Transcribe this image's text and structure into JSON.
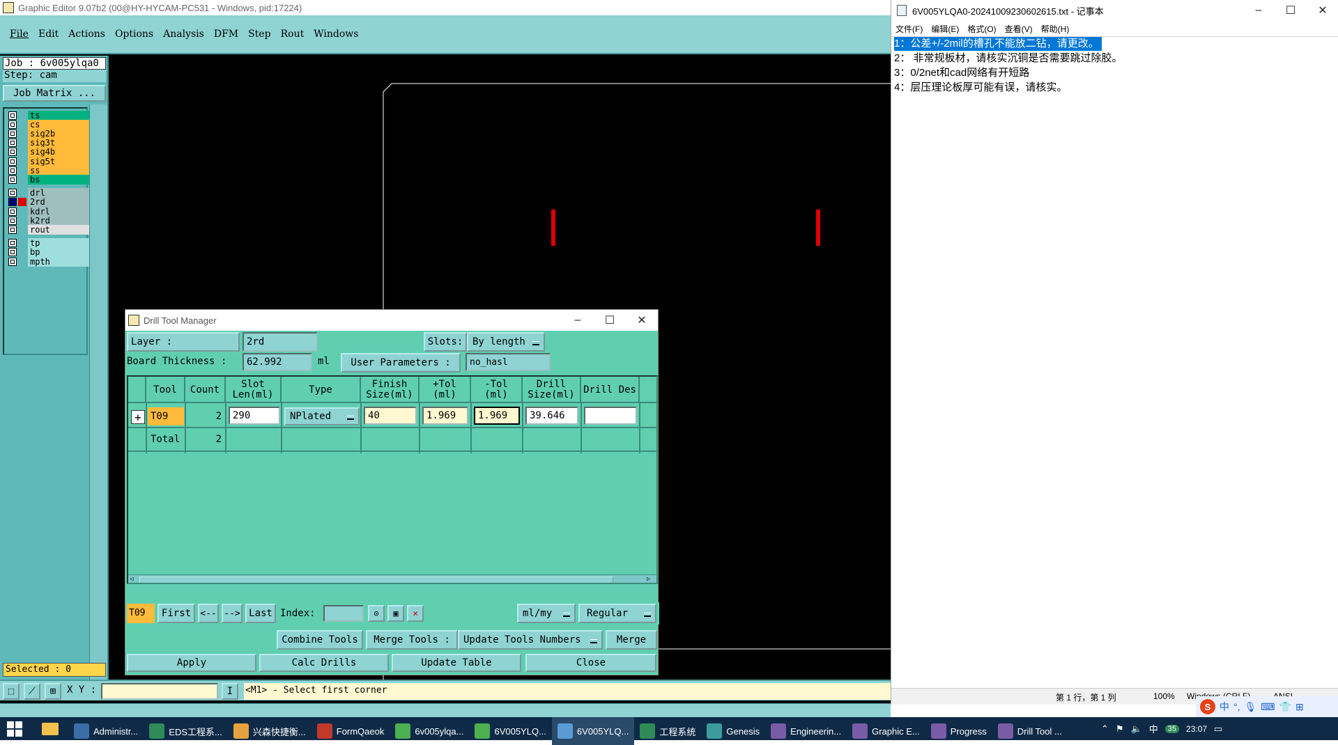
{
  "editor": {
    "title": "Graphic Editor 9.07b2 (00@HY-HYCAM-PC531 - Windows, pid:17224)",
    "menu": [
      "File",
      "Edit",
      "Actions",
      "Options",
      "Analysis",
      "DFM",
      "Step",
      "Rout",
      "Windows"
    ],
    "job_label": "Job : 6v005ylqa0",
    "step_label": "Step: cam",
    "job_matrix_button": "Job Matrix ...",
    "layers": [
      {
        "name": "ts",
        "color": "#00b27f"
      },
      {
        "name": "cs",
        "color": "#ffba3a"
      },
      {
        "name": "sig2b",
        "color": "#ffba3a"
      },
      {
        "name": "sig3t",
        "color": "#ffba3a"
      },
      {
        "name": "sig4b",
        "color": "#ffba3a"
      },
      {
        "name": "sig5t",
        "color": "#ffba3a"
      },
      {
        "name": "ss",
        "color": "#ffba3a"
      },
      {
        "name": "bs",
        "color": "#00b27f"
      },
      {
        "name": "drl",
        "color": "#9fbfbf"
      },
      {
        "name": "2rd",
        "color": "#9fbfbf"
      },
      {
        "name": "kdrl",
        "color": "#9fbfbf"
      },
      {
        "name": "k2rd",
        "color": "#9fbfbf"
      },
      {
        "name": "rout",
        "color": "#e0e0e0"
      },
      {
        "name": "tp",
        "color": "#9fdede"
      },
      {
        "name": "bp",
        "color": "#9fdede"
      },
      {
        "name": "mpth",
        "color": "#9fdede"
      }
    ],
    "selected_label": "Selected : 0",
    "xy_label": "X Y :",
    "status_message": "<M1> - Select first corner"
  },
  "dialog": {
    "title": "Drill Tool Manager",
    "layer_label": "Layer :",
    "layer_value": "2rd",
    "slots_label": "Slots:",
    "slots_value": "By length",
    "board_thickness_label": "Board Thickness :",
    "board_thickness_value": "62.992",
    "board_thickness_unit": "ml",
    "user_params_label": "User Parameters :",
    "user_params_value": "no_hasl",
    "columns": [
      "Tool",
      "Count",
      "Slot Len(ml)",
      "Type",
      "Finish Size(ml)",
      "+Tol (ml)",
      "-Tol (ml)",
      "Drill Size(ml)",
      "Drill Des"
    ],
    "row": {
      "tool": "T09",
      "count": "2",
      "slot_len": "290",
      "type": "NPlated",
      "finish": "40",
      "ptol": "1.969",
      "ntol": "1.969",
      "drill_size": "39.646",
      "drill_des": ""
    },
    "total_label": "Total",
    "total_count": "2",
    "nav_tool": "T09",
    "first": "First",
    "prev": "<--",
    "next": "-->",
    "last": "Last",
    "index_label": "Index:",
    "units": "ml/my",
    "mode": "Regular",
    "combine_tools": "Combine Tools",
    "merge_tools_label": "Merge Tools :",
    "merge_select": "Update Tools Numbers",
    "merge": "Merge",
    "apply": "Apply",
    "calc_drills": "Calc Drills",
    "update_table": "Update Table",
    "close": "Close"
  },
  "notepad": {
    "title": "6V005YLQA0-20241009230602615.txt - 记事本",
    "menu": [
      "文件(F)",
      "编辑(E)",
      "格式(O)",
      "查看(V)",
      "帮助(H)"
    ],
    "lines": [
      "1：公差+/-2mil的槽孔不能放二钻，请更改。",
      "2： 非常规板材，请核实沉铜是否需要跳过除胶。",
      "3：0/2net和cad网络有开短路",
      "4：层压理论板厚可能有误，请核实。"
    ],
    "status": {
      "position": "第 1 行，第 1 列",
      "zoom": "100%",
      "line_ending": "Windows (CRLF)",
      "encoding": "ANSI"
    }
  },
  "taskbar": {
    "items": [
      "Administr...",
      "EDS工程系...",
      "兴森快捷衡...",
      "FormQaeok",
      "6v005ylqa...",
      "6V005YLQ...",
      "6V005YLQ...",
      "工程系统",
      "Genesis",
      "Engineerin...",
      "Graphic E...",
      "Progress",
      "Drill Tool ..."
    ],
    "ime": "中",
    "time": "23:07",
    "badge": "35"
  }
}
